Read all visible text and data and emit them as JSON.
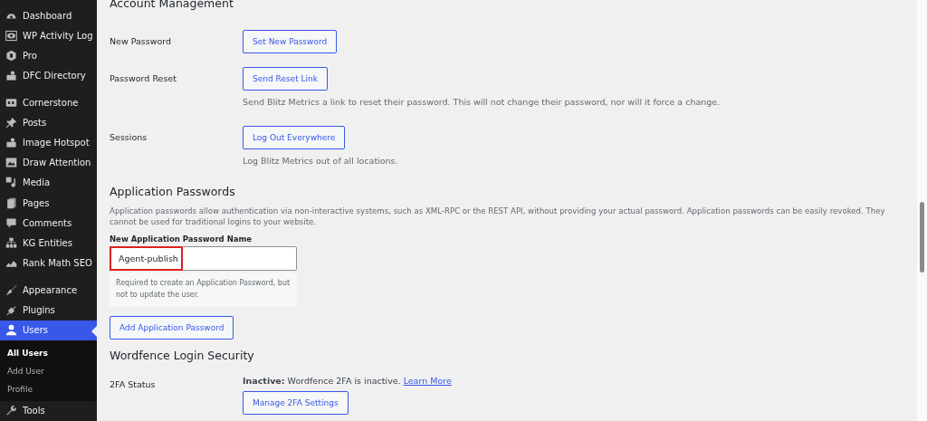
{
  "sidebar": {
    "items": [
      {
        "label": "Dashboard",
        "selected": false,
        "gap_before": false
      },
      {
        "label": "WP Activity Log",
        "selected": false,
        "gap_before": false
      },
      {
        "label": "Pro",
        "selected": false,
        "gap_before": false
      },
      {
        "label": "DFC Directory",
        "selected": false,
        "gap_before": false
      },
      {
        "label": "Cornerstone",
        "selected": false,
        "gap_before": true
      },
      {
        "label": "Posts",
        "selected": false,
        "gap_before": false
      },
      {
        "label": "Image Hotspot",
        "selected": false,
        "gap_before": false
      },
      {
        "label": "Draw Attention",
        "selected": false,
        "gap_before": false
      },
      {
        "label": "Media",
        "selected": false,
        "gap_before": false
      },
      {
        "label": "Pages",
        "selected": false,
        "gap_before": false
      },
      {
        "label": "Comments",
        "selected": false,
        "gap_before": false
      },
      {
        "label": "KG Entities",
        "selected": false,
        "gap_before": false
      },
      {
        "label": "Rank Math SEO",
        "selected": false,
        "gap_before": false
      },
      {
        "label": "Appearance",
        "selected": false,
        "gap_before": true
      },
      {
        "label": "Plugins",
        "selected": false,
        "gap_before": false
      },
      {
        "label": "Users",
        "selected": true,
        "gap_before": false,
        "children": [
          {
            "label": "All Users",
            "selected": true
          },
          {
            "label": "Add User",
            "selected": false
          },
          {
            "label": "Profile",
            "selected": false
          }
        ]
      },
      {
        "label": "Tools",
        "selected": false,
        "gap_before": false
      }
    ]
  },
  "account_management": {
    "heading": "Account Management",
    "rows": [
      {
        "label": "New Password",
        "button": "Set New Password"
      },
      {
        "label": "Password Reset",
        "button": "Send Reset Link",
        "description": "Send Blitz Metrics a link to reset their password. This will not change their password, nor will it force a change."
      },
      {
        "label": "Sessions",
        "button": "Log Out Everywhere",
        "description": "Log Blitz Metrics out of all locations."
      }
    ]
  },
  "application_passwords": {
    "heading": "Application Passwords",
    "description": "Application passwords allow authentication via non-interactive systems, such as XML-RPC or the REST API, without providing your actual password. Application passwords can be easily revoked. They cannot be used for traditional logins to your website.",
    "field_label": "New Application Password Name",
    "field_value": "Agent-publish",
    "highlighted": true,
    "help": "Required to create an Application Password, but not to update the user.",
    "button": "Add Application Password"
  },
  "wordfence": {
    "heading": "Wordfence Login Security",
    "rows": [
      {
        "label": "2FA Status",
        "status": "**Inactive:** Wordfence 2FA is inactive.",
        "link": "Learn More",
        "button": "Manage 2FA Settings"
      }
    ]
  }
}
